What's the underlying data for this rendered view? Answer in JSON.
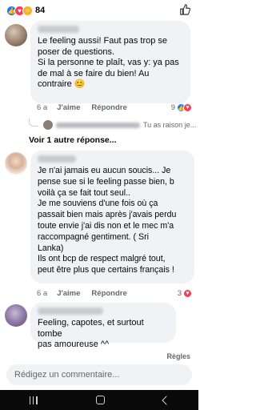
{
  "post": {
    "reaction_count": "84"
  },
  "comments": [
    {
      "text": "Le feeling aussi! Faut pas trop se\nposer de questions.\nSi la personne te plaît, vas y: ya pas\nde mal à se faire du bien! Au\ncontraire 😊",
      "time": "6 a",
      "like_label": "J'aime",
      "reply_label": "Répondre",
      "reactions": "9"
    },
    {
      "text": "Je n'ai jamais eu aucun soucis...  Je\npense sue si le feeling passe bien,  b\nvoilà ça se fait tout seul..\nJe  me souviens d'une fois où ça\npassait bien mais après j'avais perdu\ntoute envie j'ai dis non et le mec m'a\nraccompagné gentiment.  ( Sri\nLanka)\nIls ont bcp de respect malgré tout,\npeut être plus que certains français !",
      "time": "6 a",
      "like_label": "J'aime",
      "reply_label": "Répondre",
      "reactions": "3"
    },
    {
      "text": "Feeling, capotes, et surtout tombe\npas amoureuse ^^"
    }
  ],
  "reply_preview": {
    "text": "Tu as raison je..."
  },
  "see_more_label": "Voir 1 autre réponse...",
  "rules_label": "Règles",
  "composer": {
    "placeholder": "Rédigez un commentaire..."
  },
  "colors": {
    "accent": "#1877f2",
    "love": "#f33e58",
    "haha": "#f7b125",
    "bubble": "#f0f2f5",
    "muted": "#65676b"
  }
}
